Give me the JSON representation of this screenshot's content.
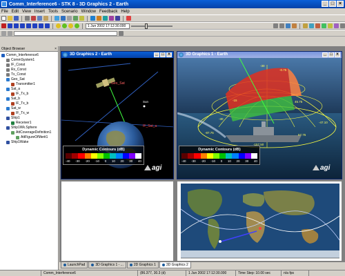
{
  "window": {
    "title": "Comm_Interference6 - STK 8 - 3D Graphics 2 - Earth",
    "controls": [
      "_",
      "□",
      "×"
    ]
  },
  "menu": [
    "File",
    "Edit",
    "View",
    "Insert",
    "Tools",
    "Scenario",
    "Window",
    "Feedback",
    "Help"
  ],
  "toolbar": {
    "time_value": "1 Jun 2002 17:12:30.000"
  },
  "object_browser": {
    "title": "Object Browser",
    "items": [
      {
        "label": "Comm_Interference6",
        "color": "#1f5fbf"
      },
      {
        "label": "CommSystem1",
        "color": "#7a7a7a"
      },
      {
        "label": "IF_Const",
        "color": "#7a7a7a"
      },
      {
        "label": "Rx_Const",
        "color": "#7a7a7a"
      },
      {
        "label": "Tx_Const",
        "color": "#7a7a7a"
      },
      {
        "label": "Geo_Sat",
        "color": "#2a7ad0"
      },
      {
        "label": "Transmitter1",
        "color": "#b04020"
      },
      {
        "label": "Sat_a",
        "color": "#2a7ad0"
      },
      {
        "label": "IF_Tx_b",
        "color": "#b04020"
      },
      {
        "label": "Sat_b",
        "color": "#2a7ad0"
      },
      {
        "label": "IF_Tx_b",
        "color": "#b04020"
      },
      {
        "label": "Sat_w",
        "color": "#2a7ad0"
      },
      {
        "label": "IF_Tx_w",
        "color": "#b04020"
      },
      {
        "label": "Ship1",
        "color": "#3050a0"
      },
      {
        "label": "Receiver1",
        "color": "#208040"
      },
      {
        "label": "Ship1Wk.Sphere",
        "color": "#3050a0"
      },
      {
        "label": "AttCoverageDefinition1",
        "color": "#60a060"
      },
      {
        "label": "AttFigureOfMerit1",
        "color": "#60a060"
      },
      {
        "label": "Ship1Wake",
        "color": "#3050a0"
      }
    ]
  },
  "windows": {
    "earth2": {
      "title": "3D Graphics 2 - Earth"
    },
    "earth1": {
      "title": "3D Graphics 1 - Earth"
    }
  },
  "legend": {
    "title": "Dynamic Contours (dB)",
    "ticks": [
      "-40",
      "-30",
      "-20",
      "-10",
      "0",
      "10",
      "20",
      "30",
      "40"
    ],
    "colors": [
      "#5a0000",
      "#a00000",
      "#ff0000",
      "#ff8000",
      "#ffff00",
      "#80ff00",
      "#00c000",
      "#00c0c0",
      "#0080ff",
      "#0000ff",
      "#8000ff",
      "#ffffff"
    ]
  },
  "brand": "agi",
  "scene_labels": {
    "geo_sat": "Geo_Sat",
    "sat": "IF_Sat_a",
    "sun": "Sun",
    "moon": "Moon",
    "el_labels": [
      "-30",
      "-0.75",
      "-15",
      "45.75",
      "-30",
      "-45",
      "-60",
      "-47.10",
      "-87.75",
      "-17.08",
      "-157.50",
      "-180.00",
      "57.75",
      "-55.50",
      "-1.5"
    ]
  },
  "tabs": [
    {
      "label": "LaunchPad"
    },
    {
      "label": "3D Graphics 1 - ..."
    },
    {
      "label": "2D Graphics 1"
    },
    {
      "label": "3D Graphics 2"
    }
  ],
  "status": {
    "scenario": "Comm_Interference6",
    "coords": "(86.377, 30.3 (d)",
    "time": "1 Jun 2002 17:12:30.000",
    "step": "Time Step: 10.00 sec",
    "rate": "n/a fps"
  }
}
